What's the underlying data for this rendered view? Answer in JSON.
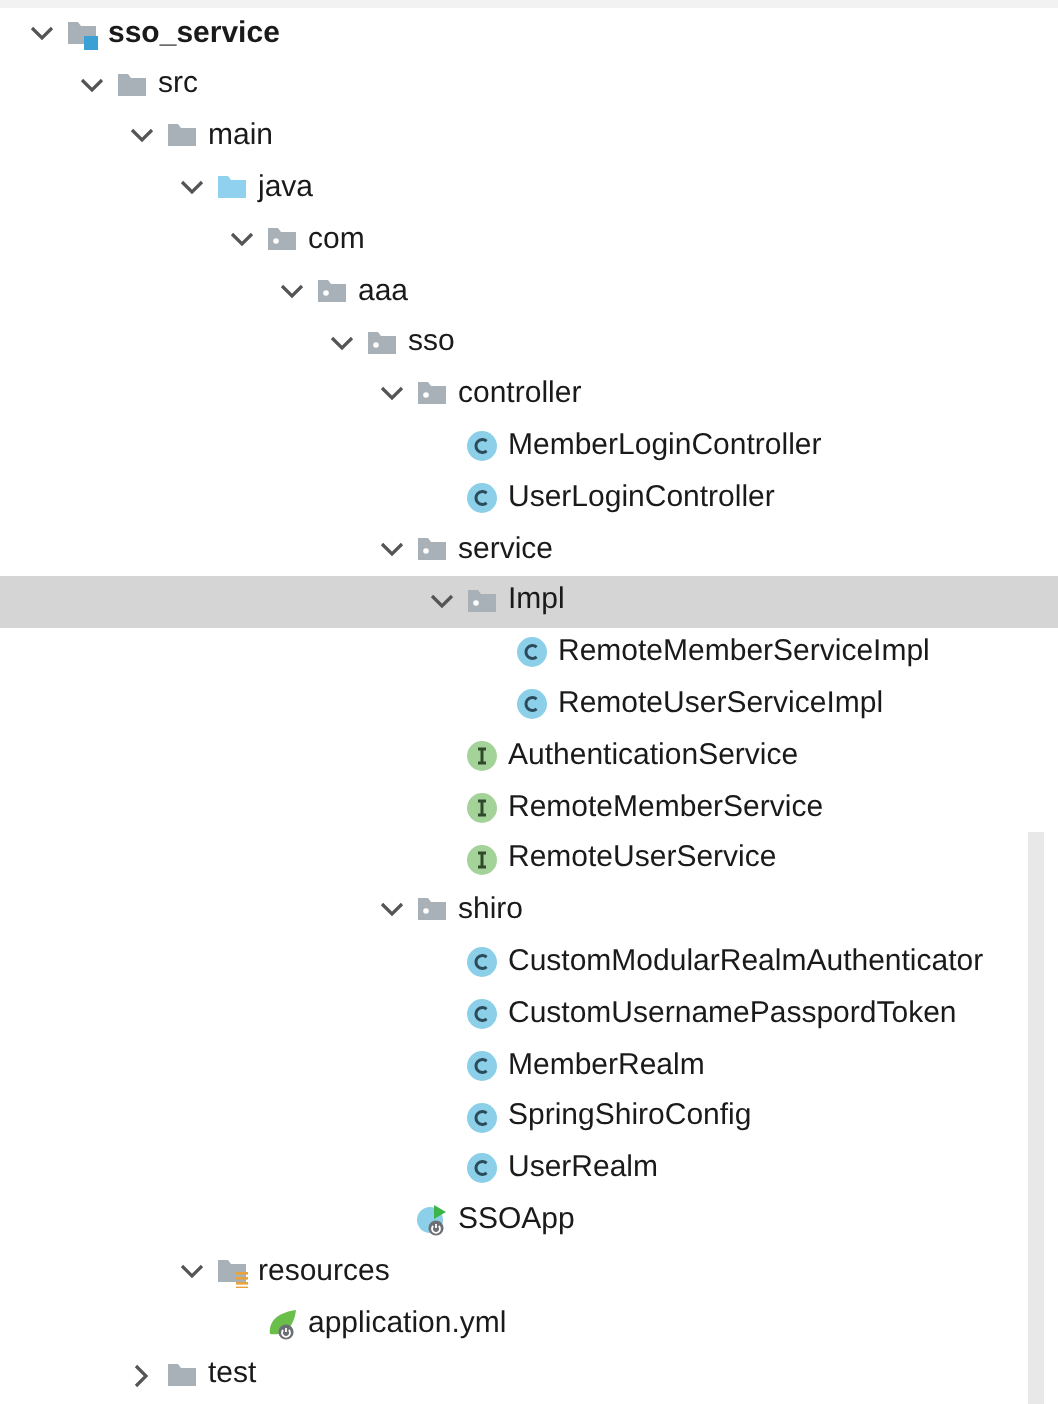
{
  "tree": [
    {
      "label": "sso_service",
      "kind": "module",
      "expanded": true,
      "selected": false,
      "children": [
        {
          "label": "src",
          "kind": "folder",
          "expanded": true,
          "selected": false,
          "children": [
            {
              "label": "main",
              "kind": "folder",
              "expanded": true,
              "selected": false,
              "children": [
                {
                  "label": "java",
                  "kind": "source",
                  "expanded": true,
                  "selected": false,
                  "children": [
                    {
                      "label": "com",
                      "kind": "package",
                      "expanded": true,
                      "selected": false,
                      "children": [
                        {
                          "label": "aaa",
                          "kind": "package",
                          "expanded": true,
                          "selected": false,
                          "children": [
                            {
                              "label": "sso",
                              "kind": "package",
                              "expanded": true,
                              "selected": false,
                              "children": [
                                {
                                  "label": "controller",
                                  "kind": "package",
                                  "expanded": true,
                                  "selected": false,
                                  "children": [
                                    {
                                      "label": "MemberLoginController",
                                      "kind": "class",
                                      "selected": false
                                    },
                                    {
                                      "label": "UserLoginController",
                                      "kind": "class",
                                      "selected": false
                                    }
                                  ]
                                },
                                {
                                  "label": "service",
                                  "kind": "package",
                                  "expanded": true,
                                  "selected": false,
                                  "children": [
                                    {
                                      "label": "Impl",
                                      "kind": "package",
                                      "expanded": true,
                                      "selected": true,
                                      "children": [
                                        {
                                          "label": "RemoteMemberServiceImpl",
                                          "kind": "class",
                                          "selected": false
                                        },
                                        {
                                          "label": "RemoteUserServiceImpl",
                                          "kind": "class",
                                          "selected": false
                                        }
                                      ]
                                    },
                                    {
                                      "label": "AuthenticationService",
                                      "kind": "interface",
                                      "selected": false
                                    },
                                    {
                                      "label": "RemoteMemberService",
                                      "kind": "interface",
                                      "selected": false
                                    },
                                    {
                                      "label": "RemoteUserService",
                                      "kind": "interface",
                                      "selected": false
                                    }
                                  ]
                                },
                                {
                                  "label": "shiro",
                                  "kind": "package",
                                  "expanded": true,
                                  "selected": false,
                                  "children": [
                                    {
                                      "label": "CustomModularRealmAuthenticator",
                                      "kind": "class",
                                      "selected": false
                                    },
                                    {
                                      "label": "CustomUsernamePasspordToken",
                                      "kind": "class",
                                      "selected": false
                                    },
                                    {
                                      "label": "MemberRealm",
                                      "kind": "class",
                                      "selected": false
                                    },
                                    {
                                      "label": "SpringShiroConfig",
                                      "kind": "class",
                                      "selected": false
                                    },
                                    {
                                      "label": "UserRealm",
                                      "kind": "class",
                                      "selected": false
                                    }
                                  ]
                                },
                                {
                                  "label": "SSOApp",
                                  "kind": "app",
                                  "selected": false
                                }
                              ]
                            }
                          ]
                        }
                      ]
                    }
                  ]
                },
                {
                  "label": "resources",
                  "kind": "resources",
                  "expanded": true,
                  "selected": false,
                  "children": [
                    {
                      "label": "application.yml",
                      "kind": "yml",
                      "selected": false
                    }
                  ]
                }
              ]
            },
            {
              "label": "test",
              "kind": "folder",
              "expanded": false,
              "selected": false
            }
          ]
        }
      ]
    }
  ]
}
